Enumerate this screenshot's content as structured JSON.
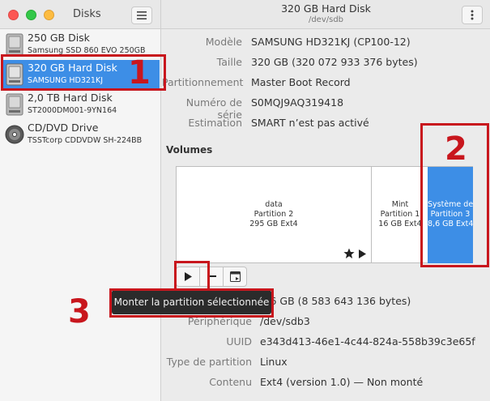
{
  "app": {
    "title": "Disks",
    "window_title": "320 GB Hard Disk",
    "window_subtitle": "/dev/sdb",
    "menu_icon": "hamburger-icon",
    "kebab_icon": "kebab-menu-icon"
  },
  "sidebar": {
    "drives": [
      {
        "name": "250 GB Disk",
        "model": "Samsung SSD 860 EVO 250GB",
        "icon": "hard-disk-icon"
      },
      {
        "name": "320 GB Hard Disk",
        "model": "SAMSUNG HD321KJ",
        "icon": "hard-disk-icon",
        "selected": true
      },
      {
        "name": "2,0 TB Hard Disk",
        "model": "ST2000DM001-9YN164",
        "icon": "hard-disk-icon"
      },
      {
        "name": "CD/DVD Drive",
        "model": "TSSTcorp CDDVDW SH-224BB",
        "icon": "optical-disc-icon"
      }
    ]
  },
  "disk_info": {
    "model_label": "Modèle",
    "model_value": "SAMSUNG HD321KJ (CP100-12)",
    "size_label": "Taille",
    "size_value": "320 GB (320 072 933 376 bytes)",
    "partitioning_label": "Partitionnement",
    "partitioning_value": "Master Boot Record",
    "serial_label": "Numéro de série",
    "serial_value": "S0MQJ9AQ319418",
    "assessment_label": "Estimation",
    "assessment_value": "SMART n’est pas activé"
  },
  "volumes": {
    "title": "Volumes",
    "partitions": [
      {
        "name": "data",
        "partition": "Partition 2",
        "info": "295 GB Ext4",
        "icons": [
          "star-icon",
          "play-icon"
        ]
      },
      {
        "name": "Mint",
        "partition": "Partition 1",
        "info": "16 GB Ext4"
      },
      {
        "name": "Système de…",
        "partition": "Partition 3",
        "info": "8,6 GB Ext4",
        "selected": true
      }
    ],
    "toolbar": [
      "play-icon",
      "minus-icon",
      "options-icon"
    ]
  },
  "partition_info": {
    "size_value": "…6 GB (8 583 643 136 bytes)",
    "device_label": "Périphérique",
    "device_value": "/dev/sdb3",
    "uuid_label": "UUID",
    "uuid_value": "e343d413-46e1-4c44-824a-558b39c3e65f",
    "type_label": "Type de partition",
    "type_value": "Linux",
    "contents_label": "Contenu",
    "contents_value": "Ext4 (version 1.0) — Non monté"
  },
  "tooltip": "Monter la partition sélectionnée",
  "annotations": {
    "one": "1",
    "two": "2",
    "three": "3"
  },
  "colors": {
    "accent": "#3d8ee6",
    "annotation": "#c8161d"
  }
}
